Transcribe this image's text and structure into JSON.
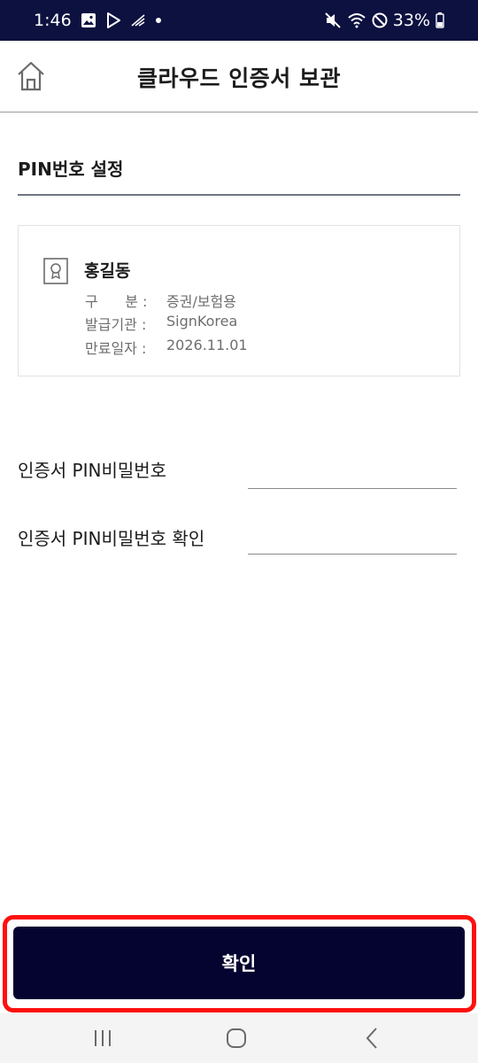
{
  "status_bar": {
    "time": "1:46",
    "battery": "33%",
    "icons_left": [
      "image-icon",
      "play-store-icon",
      "signal-activity-icon",
      "dot-icon"
    ],
    "icons_right": [
      "mute-icon",
      "wifi-icon",
      "do-not-disturb-icon",
      "battery-icon"
    ]
  },
  "header": {
    "title": "클라우드 인증서 보관",
    "home_icon": "home-icon"
  },
  "section": {
    "title": "PIN번호 설정"
  },
  "certificate": {
    "name": "홍길동",
    "rows": [
      {
        "label": "구      분 :",
        "value": "증권/보험용"
      },
      {
        "label": "발급기관 :",
        "value": "SignKorea"
      },
      {
        "label": "만료일자 :",
        "value": "2026.11.01"
      }
    ]
  },
  "form": {
    "pin_label": "인증서 PIN비밀번호",
    "pin_value": "",
    "pin_confirm_label": "인증서 PIN비밀번호 확인",
    "pin_confirm_value": ""
  },
  "actions": {
    "confirm_label": "확인"
  },
  "colors": {
    "status_bar": "#0d1140",
    "confirm_button": "#050330",
    "highlight": "#ff1010"
  }
}
